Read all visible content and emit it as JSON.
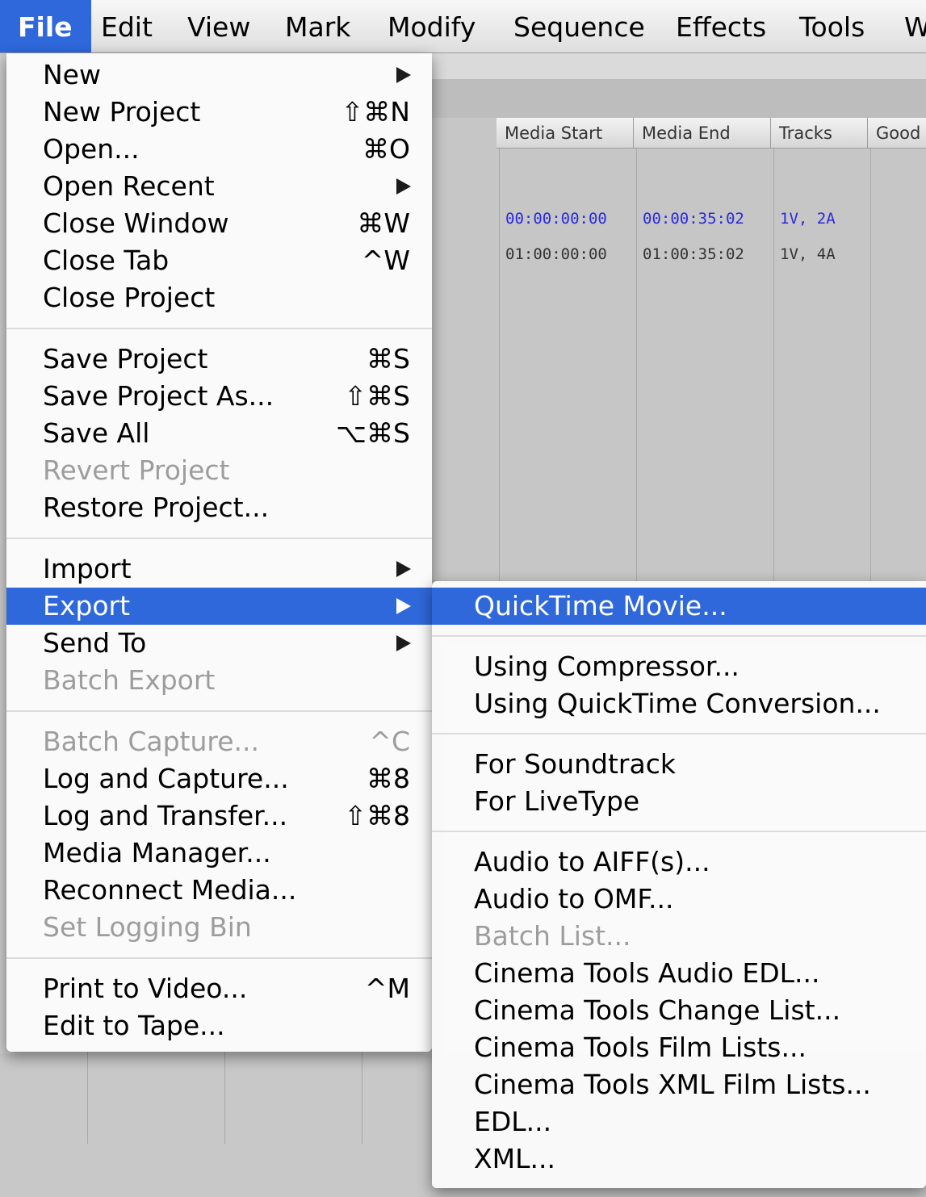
{
  "menubar": {
    "items": [
      "File",
      "Edit",
      "View",
      "Mark",
      "Modify",
      "Sequence",
      "Effects",
      "Tools",
      "W"
    ]
  },
  "browser": {
    "columns": [
      "Media Start",
      "Media End",
      "Tracks",
      "Good"
    ],
    "rows": [
      {
        "media_start": "00:00:00:00",
        "media_end": "00:00:35:02",
        "tracks": "1V, 2A"
      },
      {
        "media_start": "01:00:00:00",
        "media_end": "01:00:35:02",
        "tracks": "1V, 4A"
      }
    ]
  },
  "file_menu": {
    "items": [
      {
        "label": "New",
        "shortcut": "",
        "submenu": true,
        "disabled": false
      },
      {
        "label": "New Project",
        "shortcut": "⇧⌘N",
        "submenu": false,
        "disabled": false
      },
      {
        "label": "Open...",
        "shortcut": "⌘O",
        "submenu": false,
        "disabled": false
      },
      {
        "label": "Open Recent",
        "shortcut": "",
        "submenu": true,
        "disabled": false
      },
      {
        "label": "Close Window",
        "shortcut": "⌘W",
        "submenu": false,
        "disabled": false
      },
      {
        "label": "Close Tab",
        "shortcut": "^W",
        "submenu": false,
        "disabled": false
      },
      {
        "label": "Close Project",
        "shortcut": "",
        "submenu": false,
        "disabled": false
      },
      {
        "label": "Save Project",
        "shortcut": "⌘S",
        "submenu": false,
        "disabled": false
      },
      {
        "label": "Save Project As...",
        "shortcut": "⇧⌘S",
        "submenu": false,
        "disabled": false
      },
      {
        "label": "Save All",
        "shortcut": "⌥⌘S",
        "submenu": false,
        "disabled": false
      },
      {
        "label": "Revert Project",
        "shortcut": "",
        "submenu": false,
        "disabled": true
      },
      {
        "label": "Restore Project...",
        "shortcut": "",
        "submenu": false,
        "disabled": false
      },
      {
        "label": "Import",
        "shortcut": "",
        "submenu": true,
        "disabled": false
      },
      {
        "label": "Export",
        "shortcut": "",
        "submenu": true,
        "disabled": false,
        "highlighted": true
      },
      {
        "label": "Send To",
        "shortcut": "",
        "submenu": true,
        "disabled": false
      },
      {
        "label": "Batch Export",
        "shortcut": "",
        "submenu": false,
        "disabled": true
      },
      {
        "label": "Batch Capture...",
        "shortcut": "^C",
        "submenu": false,
        "disabled": true
      },
      {
        "label": "Log and Capture...",
        "shortcut": "⌘8",
        "submenu": false,
        "disabled": false
      },
      {
        "label": "Log and Transfer...",
        "shortcut": "⇧⌘8",
        "submenu": false,
        "disabled": false
      },
      {
        "label": "Media Manager...",
        "shortcut": "",
        "submenu": false,
        "disabled": false
      },
      {
        "label": "Reconnect Media...",
        "shortcut": "",
        "submenu": false,
        "disabled": false
      },
      {
        "label": "Set Logging Bin",
        "shortcut": "",
        "submenu": false,
        "disabled": true
      },
      {
        "label": "Print to Video...",
        "shortcut": "^M",
        "submenu": false,
        "disabled": false
      },
      {
        "label": "Edit to Tape...",
        "shortcut": "",
        "submenu": false,
        "disabled": false
      }
    ]
  },
  "export_submenu": {
    "items": [
      {
        "label": "QuickTime Movie...",
        "disabled": false,
        "highlighted": true
      },
      {
        "label": "Using Compressor...",
        "disabled": false
      },
      {
        "label": "Using QuickTime Conversion...",
        "disabled": false
      },
      {
        "label": "For Soundtrack",
        "disabled": false
      },
      {
        "label": "For LiveType",
        "disabled": false
      },
      {
        "label": "Audio to AIFF(s)...",
        "disabled": false
      },
      {
        "label": "Audio to OMF...",
        "disabled": false
      },
      {
        "label": "Batch List...",
        "disabled": true
      },
      {
        "label": "Cinema Tools Audio EDL...",
        "disabled": false
      },
      {
        "label": "Cinema Tools Change List...",
        "disabled": false
      },
      {
        "label": "Cinema Tools Film Lists...",
        "disabled": false
      },
      {
        "label": "Cinema Tools XML Film Lists...",
        "disabled": false
      },
      {
        "label": "EDL...",
        "disabled": false
      },
      {
        "label": "XML...",
        "disabled": false
      }
    ]
  },
  "colors": {
    "highlight": "#2f68db",
    "timecode_blue": "#2a2ae0",
    "disabled_text": "#9d9d9d"
  }
}
